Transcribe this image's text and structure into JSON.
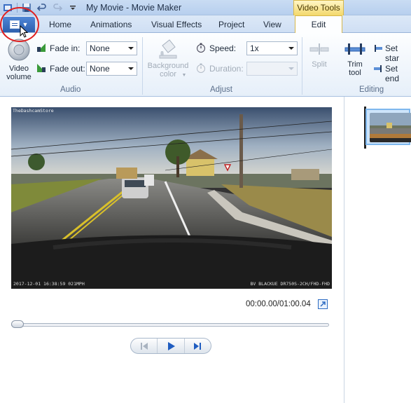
{
  "window": {
    "title": "My Movie - Movie Maker",
    "contextual_tab_group": "Video Tools"
  },
  "tabs": [
    {
      "label": "Home"
    },
    {
      "label": "Animations"
    },
    {
      "label": "Visual Effects"
    },
    {
      "label": "Project"
    },
    {
      "label": "View"
    },
    {
      "label": "Edit",
      "active": true
    }
  ],
  "ribbon": {
    "audio": {
      "group_label": "Audio",
      "video_volume_label": "Video volume",
      "fade_in_label": "Fade in:",
      "fade_in_value": "None",
      "fade_out_label": "Fade out:",
      "fade_out_value": "None"
    },
    "adjust": {
      "group_label": "Adjust",
      "background_color_label": "Background color",
      "speed_label": "Speed:",
      "speed_value": "1x",
      "duration_label": "Duration:",
      "duration_value": ""
    },
    "editing": {
      "group_label": "Editing",
      "split_label": "Split",
      "trim_tool_label": "Trim tool",
      "set_start_label": "Set star",
      "set_end_label": "Set end"
    }
  },
  "preview": {
    "watermark_top_left": "TheDashcamStore",
    "watermark_bottom_left": "2017-12-01  16:38:59  021MPH",
    "watermark_bottom_right": "BV  BLACKUE  DR750S-2CH/FHD-FHD",
    "timecode": "00:00.00/01:00.04"
  },
  "icons": {
    "file_menu": "file-menu-icon",
    "video_volume": "speaker-icon",
    "speed": "stopwatch-icon",
    "duration": "stopwatch-icon",
    "play": "play-icon",
    "previous_frame": "previous-frame-icon",
    "next_frame": "next-frame-icon",
    "fullscreen": "expand-icon"
  },
  "colors": {
    "accent_blue": "#2c5fae",
    "contextual_yellow": "#f3d86c",
    "annotation_red": "#e02020"
  }
}
